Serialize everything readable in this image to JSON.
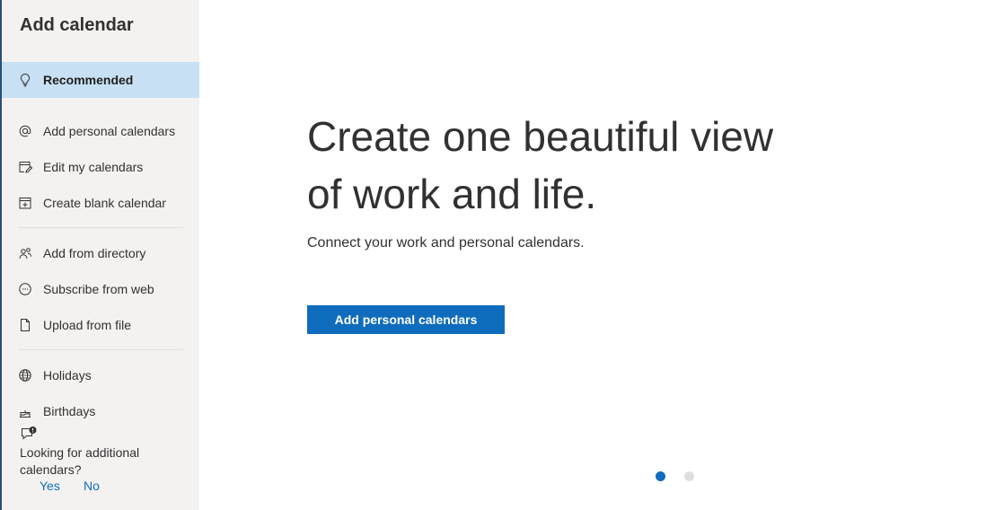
{
  "sidebar": {
    "title": "Add calendar",
    "items": [
      {
        "label": "Recommended",
        "icon": "lightbulb-icon",
        "selected": true
      },
      {
        "label": "Add personal calendars",
        "icon": "at-sign-icon"
      },
      {
        "label": "Edit my calendars",
        "icon": "edit-calendar-icon"
      },
      {
        "label": "Create blank calendar",
        "icon": "add-calendar-icon"
      },
      {
        "label": "Add from directory",
        "icon": "people-icon"
      },
      {
        "label": "Subscribe from web",
        "icon": "link-circle-icon"
      },
      {
        "label": "Upload from file",
        "icon": "document-icon"
      },
      {
        "label": "Holidays",
        "icon": "globe-icon"
      },
      {
        "label": "Birthdays",
        "icon": "cake-icon"
      }
    ],
    "feedback": {
      "question": "Looking for additional calendars?",
      "yes_label": "Yes",
      "no_label": "No"
    }
  },
  "main": {
    "headline": "Create one beautiful view of work and life.",
    "subtext": "Connect your work and personal calendars.",
    "button_label": "Add personal calendars",
    "carousel": {
      "total": 2,
      "active": 1
    }
  },
  "colors": {
    "accent": "#0f6cbd",
    "selected_bg": "#c7e0f4",
    "sidebar_bg": "#f3f2f1",
    "text": "#323130"
  }
}
